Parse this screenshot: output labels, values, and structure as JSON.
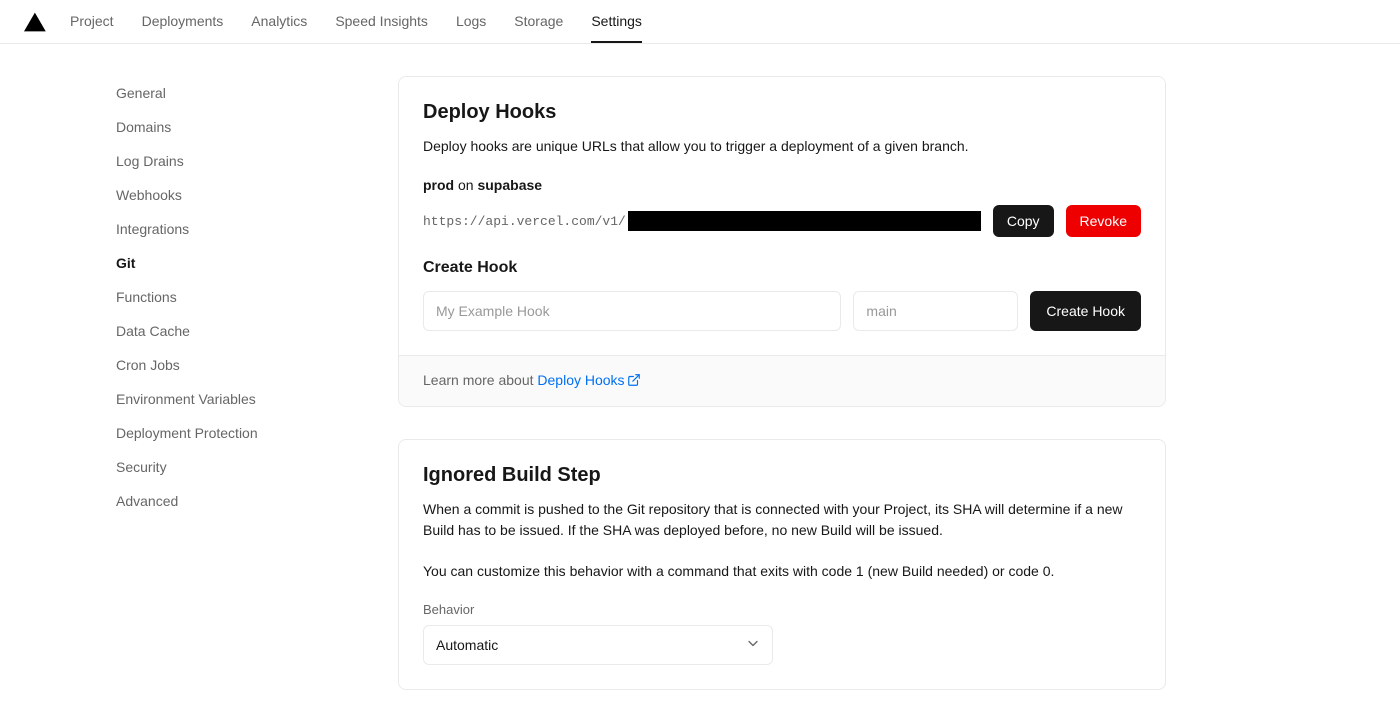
{
  "nav": {
    "tabs": [
      {
        "label": "Project",
        "active": false
      },
      {
        "label": "Deployments",
        "active": false
      },
      {
        "label": "Analytics",
        "active": false
      },
      {
        "label": "Speed Insights",
        "active": false
      },
      {
        "label": "Logs",
        "active": false
      },
      {
        "label": "Storage",
        "active": false
      },
      {
        "label": "Settings",
        "active": true
      }
    ]
  },
  "sidebar": {
    "items": [
      {
        "label": "General",
        "active": false
      },
      {
        "label": "Domains",
        "active": false
      },
      {
        "label": "Log Drains",
        "active": false
      },
      {
        "label": "Webhooks",
        "active": false
      },
      {
        "label": "Integrations",
        "active": false
      },
      {
        "label": "Git",
        "active": true
      },
      {
        "label": "Functions",
        "active": false
      },
      {
        "label": "Data Cache",
        "active": false
      },
      {
        "label": "Cron Jobs",
        "active": false
      },
      {
        "label": "Environment Variables",
        "active": false
      },
      {
        "label": "Deployment Protection",
        "active": false
      },
      {
        "label": "Security",
        "active": false
      },
      {
        "label": "Advanced",
        "active": false
      }
    ]
  },
  "deployHooks": {
    "title": "Deploy Hooks",
    "description": "Deploy hooks are unique URLs that allow you to trigger a deployment of a given branch.",
    "hook": {
      "name": "prod",
      "onWord": "on",
      "repo": "supabase",
      "urlPrefix": "https://api.vercel.com/v1/"
    },
    "copyLabel": "Copy",
    "revokeLabel": "Revoke",
    "createTitle": "Create Hook",
    "namePlaceholder": "My Example Hook",
    "branchPlaceholder": "main",
    "createButtonLabel": "Create Hook",
    "footerPrefix": "Learn more about ",
    "footerLink": "Deploy Hooks"
  },
  "ignoredBuild": {
    "title": "Ignored Build Step",
    "p1": "When a commit is pushed to the Git repository that is connected with your Project, its SHA will determine if a new Build has to be issued. If the SHA was deployed before, no new Build will be issued.",
    "p2": "You can customize this behavior with a command that exits with code 1 (new Build needed) or code 0.",
    "behaviorLabel": "Behavior",
    "behaviorValue": "Automatic"
  }
}
